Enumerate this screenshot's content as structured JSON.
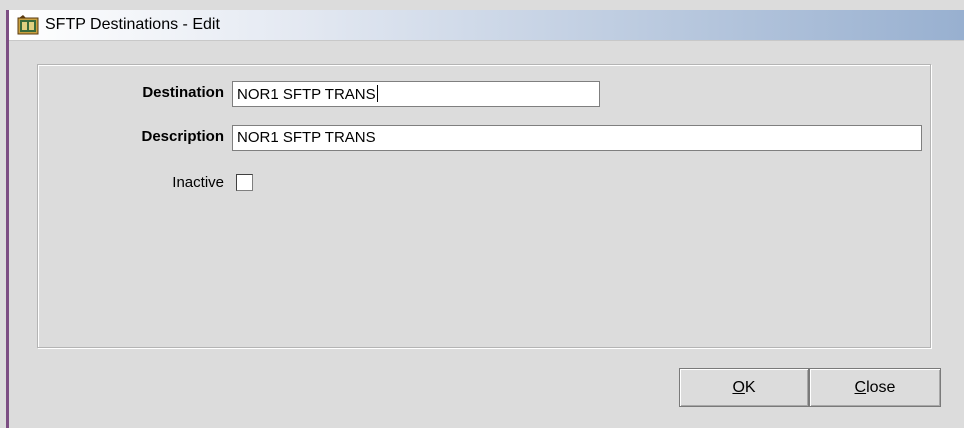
{
  "window": {
    "title": "SFTP Destinations - Edit",
    "icon": "application-icon"
  },
  "form": {
    "destination": {
      "label": "Destination",
      "value": "NOR1 SFTP TRANS"
    },
    "description": {
      "label": "Description",
      "value": "NOR1 SFTP TRANS"
    },
    "inactive": {
      "label": "Inactive",
      "checked": false
    }
  },
  "buttons": {
    "ok": {
      "mnemonic": "O",
      "rest": "K"
    },
    "close": {
      "mnemonic": "C",
      "rest": "lose"
    }
  },
  "colors": {
    "window_bg": "#dcdcdc",
    "titlebar_end": "#98b0d0",
    "left_edge": "#7c4e83"
  }
}
